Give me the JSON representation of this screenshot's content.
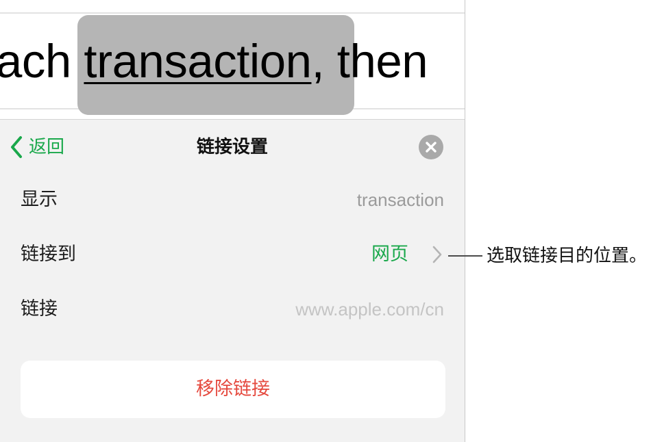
{
  "document": {
    "text_before": "ach ",
    "link_text": "transaction",
    "text_after": ", then"
  },
  "panel": {
    "back_label": "返回",
    "title": "链接设置",
    "rows": {
      "display": {
        "label": "显示",
        "value": "transaction"
      },
      "link_to": {
        "label": "链接到",
        "value": "网页"
      },
      "link": {
        "label": "链接",
        "placeholder": "www.apple.com/cn"
      }
    },
    "remove_label": "移除链接"
  },
  "callout": {
    "text": "选取链接目的位置。"
  },
  "colors": {
    "accent_green": "#1aa84b",
    "destructive_red": "#e5493e",
    "selection_gray": "#b5b5b5",
    "panel_bg": "#f2f2f2"
  },
  "icons": {
    "back": "chevron-left-icon",
    "close": "close-circle-icon",
    "disclosure": "chevron-right-icon"
  }
}
